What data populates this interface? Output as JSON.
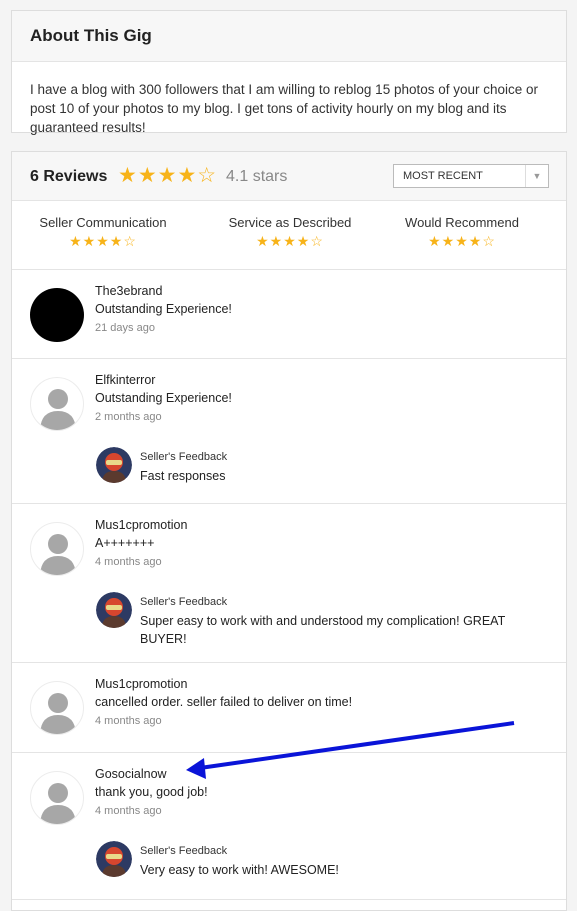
{
  "about": {
    "title": "About This Gig",
    "description": "I have a blog with 300 followers that I am willing to reblog 15 photos of your choice or post 10 of your photos to my blog.  I get tons of activity hourly on my blog and its guaranteed results!"
  },
  "reviews_header": {
    "count_label": "6 Reviews",
    "stars": "★★★★☆",
    "rating_label": "4.1 stars",
    "sort_selected": "MOST RECENT"
  },
  "criteria": [
    {
      "label": "Seller Communication",
      "stars": "★★★★☆"
    },
    {
      "label": "Service as Described",
      "stars": "★★★★☆"
    },
    {
      "label": "Would Recommend",
      "stars": "★★★★☆"
    }
  ],
  "reviews": [
    {
      "user": "The3ebrand",
      "text": "Outstanding Experience!",
      "time": "21 days ago"
    },
    {
      "user": "Elfkinterror",
      "text": "Outstanding Experience!",
      "time": "2 months ago",
      "feedback_label": "Seller's Feedback",
      "feedback_text": "Fast responses"
    },
    {
      "user": "Mus1cpromotion",
      "text": "A+++++++",
      "time": "4 months ago",
      "feedback_label": "Seller's Feedback",
      "feedback_text": "Super easy to work with and understood my complication! GREAT BUYER!"
    },
    {
      "user": "Mus1cpromotion",
      "text": "cancelled order. seller failed to deliver on time!",
      "time": "4 months ago"
    },
    {
      "user": "Gosocialnow",
      "text": "thank you, good job!",
      "time": "4 months ago",
      "feedback_label": "Seller's Feedback",
      "feedback_text": "Very easy to work with! AWESOME!"
    }
  ],
  "colors": {
    "star": "#f7b319",
    "annotation_arrow": "#0a14d8"
  }
}
